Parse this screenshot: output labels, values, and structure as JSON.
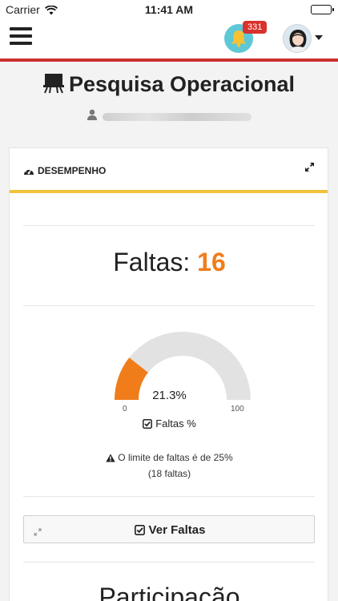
{
  "status_bar": {
    "carrier": "Carrier",
    "time": "11:41 AM"
  },
  "navbar": {
    "notification_count": "331",
    "icons": [
      "menu-icon",
      "bell-icon",
      "avatar",
      "chevron-down-icon"
    ],
    "colors": {
      "bell_bg": "#5ec8d6",
      "badge": "#d9312b",
      "rule": "#c9302c"
    }
  },
  "page": {
    "title": "Pesquisa Operacional",
    "title_icon": "classroom-icon",
    "user_name_blurred": true
  },
  "panel": {
    "header": "DESEMPENHO",
    "header_icon": "dashboard-icon",
    "accent": "#f0c23a"
  },
  "faltas": {
    "label": "Faltas: ",
    "value": "16",
    "color": "#f07d1a"
  },
  "gauge": {
    "value_label": "21.3%",
    "value_fraction": 0.213,
    "min": "0",
    "max": "100",
    "caption": "Faltas %",
    "fill_color": "#f07d1a",
    "track_color": "#e2e2e2"
  },
  "limit": {
    "line1": "O limite de faltas é de 25%",
    "line2": "(18 faltas)"
  },
  "ver_faltas": {
    "label": "Ver Faltas"
  },
  "next_section": {
    "title": "Participação"
  }
}
